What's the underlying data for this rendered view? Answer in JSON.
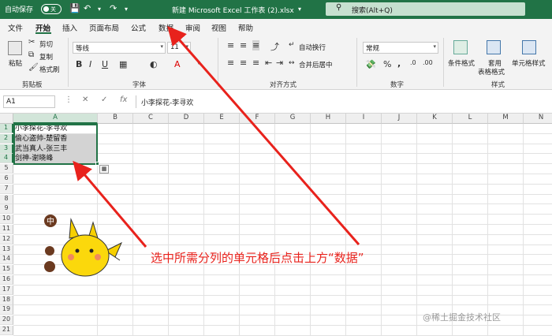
{
  "titlebar": {
    "autosave_label": "自动保存",
    "autosave_state": "关",
    "doc_title": "新建 Microsoft Excel 工作表 (2).xlsx",
    "search_placeholder": "搜索(Alt+Q)"
  },
  "tabs": [
    "文件",
    "开始",
    "插入",
    "页面布局",
    "公式",
    "数据",
    "审阅",
    "视图",
    "帮助"
  ],
  "ribbon": {
    "clipboard": {
      "paste": "粘贴",
      "cut": "剪切",
      "copy": "复制",
      "format_painter": "格式刷",
      "label": "剪贴板"
    },
    "font": {
      "name": "等线",
      "size": "11",
      "label": "字体",
      "bold": "B",
      "italic": "I",
      "underline": "U",
      "font_color": "A",
      "grow": "A",
      "shrink": "A"
    },
    "alignment": {
      "wrap": "自动换行",
      "merge": "合并后居中",
      "label": "对齐方式"
    },
    "number": {
      "format": "常规",
      "percent": "%",
      "comma": ",",
      "label": "数字"
    },
    "styles": {
      "conditional": "条件格式",
      "table_line1": "套用",
      "table_line2": "表格格式",
      "cell_styles": "单元格样式",
      "label": "样式"
    }
  },
  "formula_bar": {
    "name_box": "A1",
    "fx": "fx",
    "cancel": "✕",
    "enter": "✓",
    "content": "小李探花-李寻欢"
  },
  "columns": [
    "A",
    "B",
    "C",
    "D",
    "E",
    "F",
    "G",
    "H",
    "I",
    "J",
    "K",
    "L",
    "M",
    "N"
  ],
  "rows": [
    "1",
    "2",
    "3",
    "4",
    "5",
    "6",
    "7",
    "8",
    "9",
    "10",
    "11",
    "12",
    "13",
    "14",
    "15",
    "16",
    "17",
    "18",
    "19",
    "20",
    "21"
  ],
  "cells": [
    "小李探花-李寻欢",
    "偷心盗帅-楚留香",
    "武当真人-张三丰",
    "剑神-谢晓峰"
  ],
  "annotation": "选中所需分列的单元格后点击上方“数据”",
  "sticker_char": "中",
  "watermark": "@稀土掘金技术社区"
}
